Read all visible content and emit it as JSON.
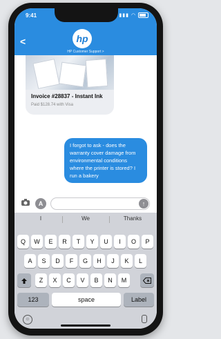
{
  "status_bar": {
    "time": "9:41"
  },
  "header": {
    "back_icon": "chevron-left-icon",
    "logo_text": "hp",
    "subtitle": "HP Customer Support >"
  },
  "card": {
    "title": "Invoice #28837 - Instant Ink",
    "subtitle": "Paid $128.74 with Visa"
  },
  "message": {
    "text": "I forgot to ask - does the warranty cover damage from environmental conditions where the printer is stored? I run a bakery"
  },
  "composer": {
    "camera_icon": "camera-icon",
    "apps_icon": "app-store-icon",
    "send_icon": "arrow-up-icon"
  },
  "keyboard": {
    "suggestions": [
      "I",
      "We",
      "Thanks"
    ],
    "row1": [
      "Q",
      "W",
      "E",
      "R",
      "T",
      "Y",
      "U",
      "I",
      "O",
      "P"
    ],
    "row2": [
      "A",
      "S",
      "D",
      "F",
      "G",
      "H",
      "J",
      "K",
      "L"
    ],
    "row3": [
      "Z",
      "X",
      "C",
      "V",
      "B",
      "N",
      "M"
    ],
    "numbers_key": "123",
    "space_key": "space",
    "return_key": "Label"
  },
  "colors": {
    "accent": "#2a8ce0"
  }
}
